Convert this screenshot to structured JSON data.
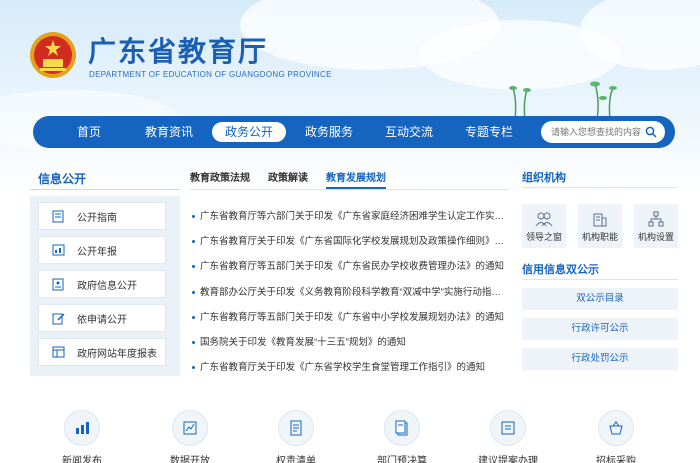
{
  "header": {
    "title": "广东省教育厅",
    "subtitle": "DEPARTMENT OF EDUCATION OF GUANGDONG PROVINCE"
  },
  "nav": {
    "items": [
      "首页",
      "教育资讯",
      "政务公开",
      "政务服务",
      "互动交流",
      "专题专栏"
    ],
    "active_index": 2,
    "search_placeholder": "请输入您想查找的内容"
  },
  "left_panel": {
    "title": "信息公开",
    "items": [
      {
        "label": "公开指南",
        "icon": "document-icon"
      },
      {
        "label": "公开年报",
        "icon": "report-icon"
      },
      {
        "label": "政府信息公开",
        "icon": "info-icon"
      },
      {
        "label": "依申请公开",
        "icon": "edit-icon"
      },
      {
        "label": "政府网站年度报表",
        "icon": "table-icon"
      }
    ]
  },
  "middle": {
    "tabs": [
      "教育政策法规",
      "政策解读",
      "教育发展规划"
    ],
    "active_tab": 2,
    "news": [
      "广东省教育厅等六部门关于印发《广东省家庭经济困难学生认定工作实施办法》的通知",
      "广东省教育厅关于印发《广东省国际化学校发展规划及政策操作细则》的通知",
      "广东省教育厅等五部门关于印发《广东省民办学校收费管理办法》的通知",
      "教育部办公厅关于印发《义务教育阶段科学教育“双减中学”实施行动指南》的通知",
      "广东省教育厅等五部门关于印发《广东省中小学校发展规划办法》的通知",
      "国务院关于印发《教育发展“十三五”规划》的通知",
      "广东省教育厅关于印发《广东省学校学生食堂管理工作指引》的通知"
    ]
  },
  "right_panel": {
    "org_title": "组织机构",
    "org_items": [
      {
        "label": "领导之窗",
        "icon": "people-icon"
      },
      {
        "label": "机构职能",
        "icon": "building-icon"
      },
      {
        "label": "机构设置",
        "icon": "org-chart-icon"
      }
    ],
    "credit_title": "信用信息双公示",
    "credit_items": [
      "双公示目录",
      "行政许可公示",
      "行政处罚公示"
    ]
  },
  "bottom": {
    "items": [
      {
        "label": "新闻发布",
        "icon": "chart-icon"
      },
      {
        "label": "数据开放",
        "icon": "data-icon"
      },
      {
        "label": "权责清单",
        "icon": "list-icon"
      },
      {
        "label": "部门预决算",
        "icon": "budget-icon"
      },
      {
        "label": "建议提案办理",
        "icon": "proposal-icon"
      },
      {
        "label": "招标采购",
        "icon": "basket-icon"
      }
    ]
  },
  "colors": {
    "primary": "#1565c0",
    "panel_bg": "#eaf1f9"
  }
}
